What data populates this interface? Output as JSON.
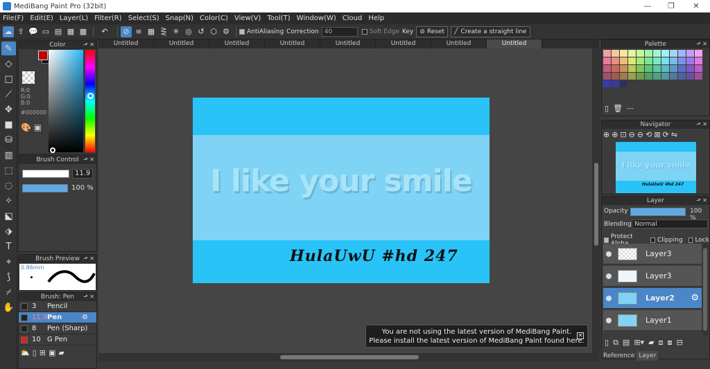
{
  "window": {
    "title": "MediBang Paint Pro (32bit)",
    "minimize": "—",
    "restore": "❐",
    "close": "✕"
  },
  "menu": [
    "File(F)",
    "Edit(E)",
    "Layer(L)",
    "Filter(R)",
    "Select(S)",
    "Snap(N)",
    "Color(C)",
    "View(V)",
    "Tool(T)",
    "Window(W)",
    "Cloud",
    "Help"
  ],
  "toolbar": {
    "antialias": "AntiAliasing",
    "correction_label": "Correction",
    "correction_value": "40",
    "soft_edge": "Soft Edge",
    "key_label": "Key",
    "reset": "Reset",
    "straight_line": "Create a straight line"
  },
  "color_panel": {
    "title": "Color",
    "rgb": [
      "R:0",
      "G:0",
      "B:0"
    ],
    "hex": "#000000",
    "fg": "#b00000"
  },
  "brush_control": {
    "title": "Brush Control",
    "size": "11.9",
    "opacity": "100 %"
  },
  "brush_preview": {
    "title": "Brush Preview",
    "size_label": "0.86mm"
  },
  "brush_list": {
    "title": "Brush: Pen",
    "items": [
      {
        "size": "3",
        "name": "Pencil",
        "color": "#222222",
        "selected": false
      },
      {
        "size": "11.9",
        "name": "Pen",
        "color": "#222222",
        "selected": true
      },
      {
        "size": "8",
        "name": "Pen (Sharp)",
        "color": "#222222",
        "selected": false
      },
      {
        "size": "10",
        "name": "G Pen",
        "color": "#e02020",
        "selected": false
      }
    ]
  },
  "tabs": [
    "Untitled",
    "Untitled",
    "Untitled",
    "Untitled",
    "Untitled",
    "Untitled",
    "Untitled",
    "Untitled"
  ],
  "artwork": {
    "headline": "I like your smile",
    "signature": "HulaUwU #hd 247"
  },
  "notification": {
    "line1": "You are not using the latest version of MediBang Paint.",
    "line2": "Please install the latest version of MediBang Paint found here.",
    "close": "✕"
  },
  "palette": {
    "title": "Palette",
    "colors": [
      "#f2a0a0",
      "#f5c9a0",
      "#f5e6a0",
      "#e6f5a0",
      "#c9f5a0",
      "#a0f5a8",
      "#a0f5d0",
      "#a0f0f5",
      "#a0d6f5",
      "#a0b6f5",
      "#c0a0f5",
      "#f0a0f5",
      "#e87a9c",
      "#e8907a",
      "#e8bf7a",
      "#dfe87a",
      "#a8e87a",
      "#7ae88e",
      "#7ae8c6",
      "#7ae0e8",
      "#7abce8",
      "#7a92e8",
      "#9e7ae8",
      "#e07ae8",
      "#c85a78",
      "#c86a5a",
      "#c8945a",
      "#c0c85a",
      "#80c85a",
      "#5ac870",
      "#5ac8a4",
      "#5abcc8",
      "#5a98c8",
      "#5a70c8",
      "#7c5ac8",
      "#c05ac8",
      "#a0506a",
      "#a05a50",
      "#a07a50",
      "#9aa050",
      "#6aa050",
      "#50a060",
      "#50a088",
      "#509aa0",
      "#5078a0",
      "#5060a0",
      "#6a50a0",
      "#9a50a0",
      "#3a3ab0",
      "#3a3a98",
      "#303060"
    ],
    "empty": "---"
  },
  "navigator": {
    "title": "Navigator"
  },
  "layer_panel": {
    "title": "Layer",
    "opacity_label": "Opacity",
    "opacity_value": "100 %",
    "blending_label": "Blending",
    "blending_value": "Normal",
    "protect_alpha": "Protect Alpha",
    "clipping": "Clipping",
    "lock": "Lock",
    "layers": [
      {
        "name": "Layer3",
        "selected": false
      },
      {
        "name": "Layer3",
        "selected": false
      },
      {
        "name": "Layer2",
        "selected": true
      },
      {
        "name": "Layer1",
        "selected": false
      }
    ]
  },
  "bottom_tabs": [
    "Reference",
    "Layer"
  ]
}
